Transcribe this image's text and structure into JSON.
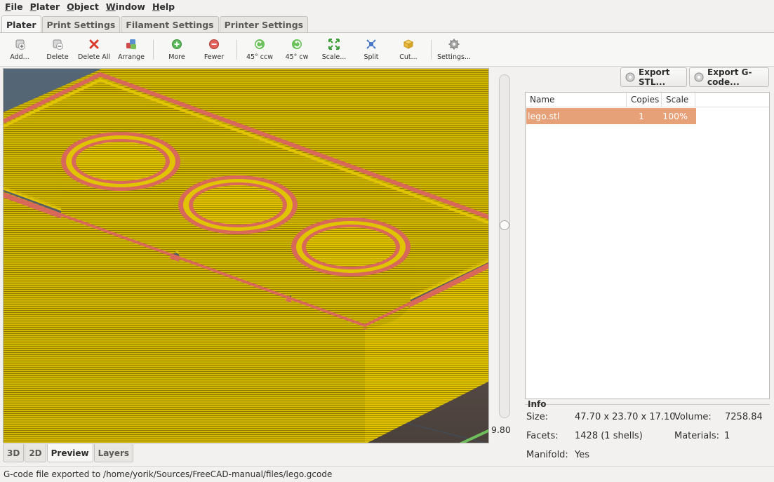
{
  "menubar": {
    "items": [
      {
        "key": "F",
        "rest": "ile"
      },
      {
        "key": "P",
        "rest": "later"
      },
      {
        "key": "O",
        "rest": "bject"
      },
      {
        "key": "W",
        "rest": "indow"
      },
      {
        "key": "H",
        "rest": "elp"
      }
    ]
  },
  "tabs": [
    "Plater",
    "Print Settings",
    "Filament Settings",
    "Printer Settings"
  ],
  "toolbar": {
    "add": "Add...",
    "delete": "Delete",
    "delete_all": "Delete All",
    "arrange": "Arrange",
    "more": "More",
    "fewer": "Fewer",
    "rotate_ccw": "45° ccw",
    "rotate_cw": "45° cw",
    "scale": "Scale...",
    "split": "Split",
    "cut": "Cut...",
    "settings": "Settings..."
  },
  "view": {
    "layer_height": "9.80",
    "tabs": [
      "3D",
      "2D",
      "Preview",
      "Layers"
    ],
    "active_tab": "Preview"
  },
  "export": {
    "stl": "Export STL...",
    "gcode": "Export G-code..."
  },
  "objects": {
    "columns": [
      "Name",
      "Copies",
      "Scale"
    ],
    "rows": [
      {
        "name": "lego.stl",
        "copies": "1",
        "scale": "100%"
      }
    ]
  },
  "info": {
    "title": "Info",
    "size_label": "Size:",
    "size_value": "47.70 x 23.70 x 17.10",
    "volume_label": "Volume:",
    "volume_value": "7258.84",
    "facets_label": "Facets:",
    "facets_value": "1428 (1 shells)",
    "materials_label": "Materials:",
    "materials_value": "1",
    "manifold_label": "Manifold:",
    "manifold_value": "Yes"
  },
  "status": "G-code file exported to /home/yorik/Sources/FreeCAD-manual/files/lego.gcode",
  "colors": {
    "model_yellow": "#c9b000",
    "perimeter_red": "#d8685a",
    "bed_blue": "#4e6272",
    "travel_green": "#6dbb5a",
    "selection": "#e7a178"
  }
}
